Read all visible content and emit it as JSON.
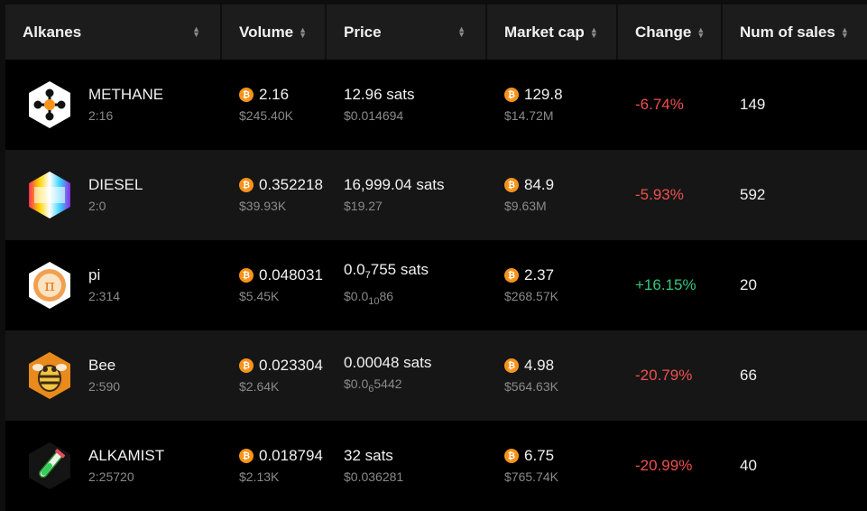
{
  "header": {
    "alkanes": "Alkanes",
    "volume": "Volume",
    "price": "Price",
    "market_cap": "Market cap",
    "change": "Change",
    "num_sales": "Num of sales"
  },
  "colors": {
    "negative": "#ef4f4f",
    "positive": "#34c77b",
    "btc": "#f7931a"
  },
  "rows": [
    {
      "name": "METHANE",
      "id": "2:16",
      "icon": "methane-icon",
      "volume_btc": "2.16",
      "volume_usd": "$245.40K",
      "price_sats": "12.96 sats",
      "price_usd": "$0.014694",
      "mcap_btc": "129.8",
      "mcap_usd": "$14.72M",
      "change": "-6.74%",
      "sales": "149"
    },
    {
      "name": "DIESEL",
      "id": "2:0",
      "icon": "diesel-icon",
      "volume_btc": "0.352218",
      "volume_usd": "$39.93K",
      "price_sats": "16,999.04 sats",
      "price_usd": "$19.27",
      "mcap_btc": "84.9",
      "mcap_usd": "$9.63M",
      "change": "-5.93%",
      "sales": "592"
    },
    {
      "name": "pi",
      "id": "2:314",
      "icon": "pi-icon",
      "volume_btc": "0.048031",
      "volume_usd": "$5.45K",
      "price_sats_pre": "0.0",
      "price_sats_sub": "7",
      "price_sats_post": "755 sats",
      "price_usd_pre": "$0.0",
      "price_usd_sub": "10",
      "price_usd_post": "86",
      "mcap_btc": "2.37",
      "mcap_usd": "$268.57K",
      "change": "+16.15%",
      "sales": "20"
    },
    {
      "name": "Bee",
      "id": "2:590",
      "icon": "bee-icon",
      "volume_btc": "0.023304",
      "volume_usd": "$2.64K",
      "price_sats": "0.00048 sats",
      "price_usd_pre": "$0.0",
      "price_usd_sub": "6",
      "price_usd_post": "5442",
      "mcap_btc": "4.98",
      "mcap_usd": "$564.63K",
      "change": "-20.79%",
      "sales": "66"
    },
    {
      "name": "ALKAMIST",
      "id": "2:25720",
      "icon": "alkamist-icon",
      "volume_btc": "0.018794",
      "volume_usd": "$2.13K",
      "price_sats": "32 sats",
      "price_usd": "$0.036281",
      "mcap_btc": "6.75",
      "mcap_usd": "$765.74K",
      "change": "-20.99%",
      "sales": "40"
    }
  ]
}
